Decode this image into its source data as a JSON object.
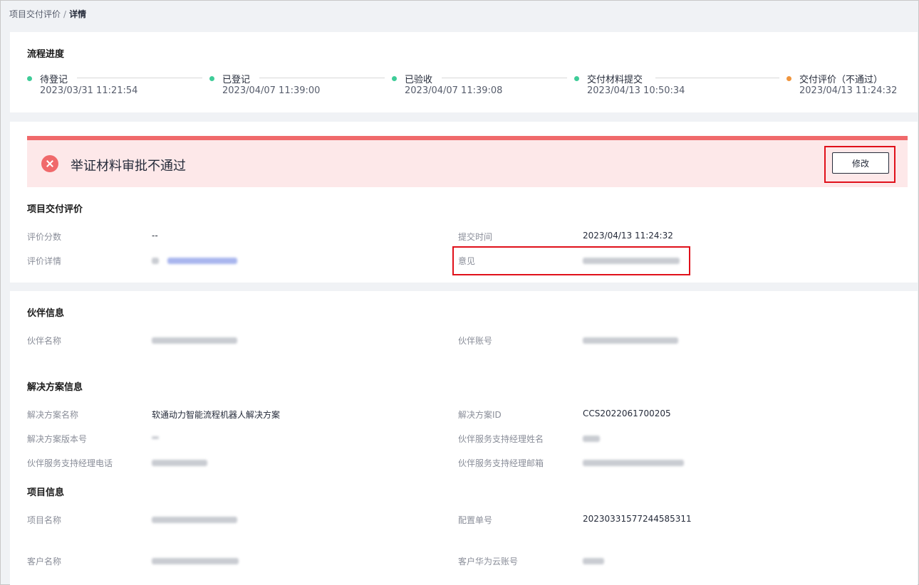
{
  "breadcrumb": {
    "parent": "项目交付评价",
    "separator": "/",
    "current": "详情"
  },
  "progress": {
    "title": "流程进度",
    "steps": [
      {
        "label": "待登记",
        "time": "2023/03/31 11:21:54",
        "color": "#3fcc98"
      },
      {
        "label": "已登记",
        "time": "2023/04/07 11:39:00",
        "color": "#3fcc98"
      },
      {
        "label": "已验收",
        "time": "2023/04/07 11:39:08",
        "color": "#3fcc98"
      },
      {
        "label": "交付材料提交",
        "time": "2023/04/13 10:50:34",
        "color": "#3fcc98"
      },
      {
        "label": "交付评价（不通过）",
        "time": "2023/04/13 11:24:32",
        "color": "#f0953d"
      }
    ]
  },
  "alert": {
    "message": "举证材料审批不通过",
    "button_label": "修改",
    "color": "#f0696b"
  },
  "evaluation": {
    "title": "项目交付评价",
    "score_label": "评价分数",
    "score_value": "--",
    "submit_time_label": "提交时间",
    "submit_time_value": "2023/04/13 11:24:32",
    "detail_label": "评价详情",
    "opinion_label": "意见"
  },
  "partner": {
    "title": "伙伴信息",
    "name_label": "伙伴名称",
    "account_label": "伙伴账号"
  },
  "solution": {
    "title": "解决方案信息",
    "name_label": "解决方案名称",
    "name_value": "软通动力智能流程机器人解决方案",
    "id_label": "解决方案ID",
    "id_value": "CCS2022061700205",
    "version_label": "解决方案版本号",
    "manager_name_label": "伙伴服务支持经理姓名",
    "manager_phone_label": "伙伴服务支持经理电话",
    "manager_email_label": "伙伴服务支持经理邮箱"
  },
  "project": {
    "title": "项目信息",
    "name_label": "项目名称",
    "config_no_label": "配置单号",
    "config_no_value": "20230331577244585311",
    "customer_label": "客户名称",
    "customer_account_label": "客户华为云账号"
  }
}
